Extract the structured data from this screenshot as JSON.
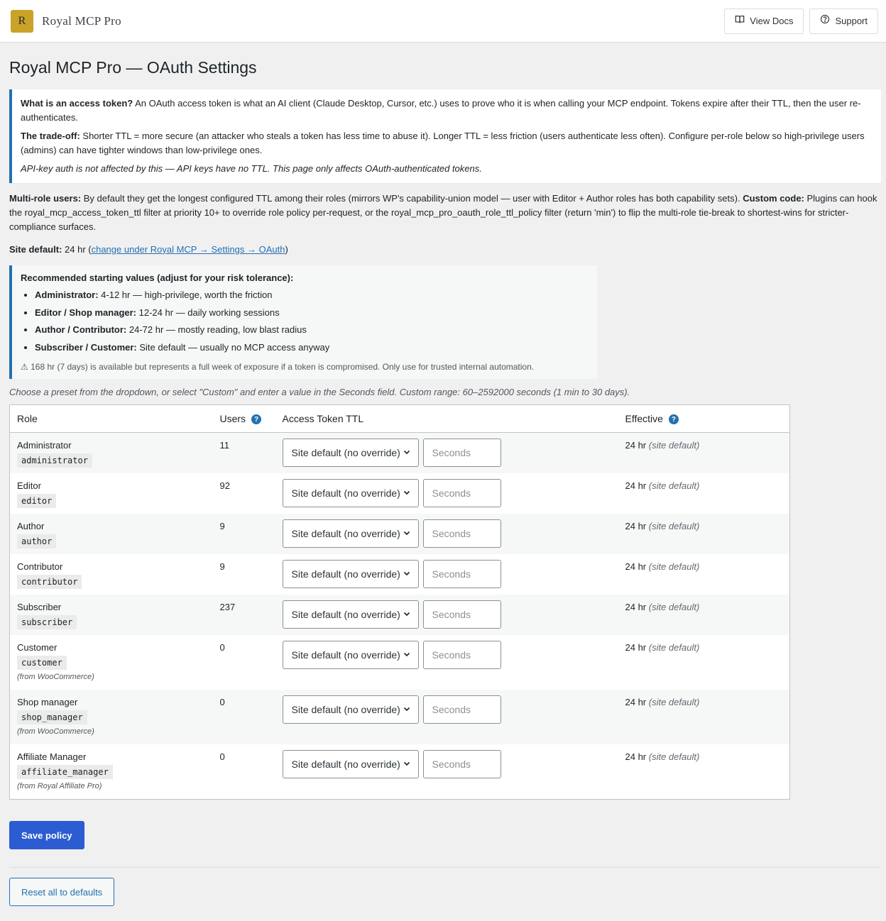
{
  "header": {
    "logo_letter": "R",
    "brand": "Royal MCP Pro",
    "view_docs": "View Docs",
    "support": "Support"
  },
  "page_title": "Royal MCP Pro — OAuth Settings",
  "notice": {
    "q_label": "What is an access token?",
    "q_text": " An OAuth access token is what an AI client (Claude Desktop, Cursor, etc.) uses to prove who it is when calling your MCP endpoint. Tokens expire after their TTL, then the user re-authenticates.",
    "trade_label": "The trade-off:",
    "trade_text": " Shorter TTL = more secure (an attacker who steals a token has less time to abuse it). Longer TTL = less friction (users authenticate less often). Configure per-role below so high-privilege users (admins) can have tighter windows than low-privilege ones.",
    "apikey_text": "API-key auth is not affected by this — API keys have no TTL. This page only affects OAuth-authenticated tokens."
  },
  "multirole": {
    "label": "Multi-role users:",
    "text": " By default they get the longest configured TTL among their roles (mirrors WP's capability-union model — user with Editor + Author roles has both capability sets). ",
    "custom_label": "Custom code:",
    "custom_text": " Plugins can hook the royal_mcp_access_token_ttl filter at priority 10+ to override role policy per-request, or the royal_mcp_pro_oauth_role_ttl_policy filter (return 'min') to flip the multi-role tie-break to shortest-wins for stricter-compliance surfaces."
  },
  "site_default": {
    "label": "Site default:",
    "value": " 24 hr (",
    "link": "change under Royal MCP → Settings → OAuth",
    "close": ")"
  },
  "recommended": {
    "title": "Recommended starting values (adjust for your risk tolerance):",
    "items": [
      {
        "role": "Administrator:",
        "text": " 4-12 hr — high-privilege, worth the friction"
      },
      {
        "role": "Editor / Shop manager:",
        "text": " 12-24 hr — daily working sessions"
      },
      {
        "role": "Author / Contributor:",
        "text": " 24-72 hr — mostly reading, low blast radius"
      },
      {
        "role": "Subscriber / Customer:",
        "text": " Site default — usually no MCP access anyway"
      }
    ],
    "warning": "⚠ 168 hr (7 days) is available but represents a full week of exposure if a token is compromised. Only use for trusted internal automation."
  },
  "hint": "Choose a preset from the dropdown, or select \"Custom\" and enter a value in the Seconds field. Custom range: 60–2592000 seconds (1 min to 30 days).",
  "table": {
    "headers": {
      "role": "Role",
      "users": "Users",
      "ttl": "Access Token TTL",
      "effective": "Effective"
    },
    "select_value": "Site default (no override)",
    "seconds_placeholder": "Seconds",
    "effective_value": "24 hr",
    "effective_note": "(site default)",
    "rows": [
      {
        "name": "Administrator",
        "slug": "administrator",
        "users": "11",
        "from": ""
      },
      {
        "name": "Editor",
        "slug": "editor",
        "users": "92",
        "from": ""
      },
      {
        "name": "Author",
        "slug": "author",
        "users": "9",
        "from": ""
      },
      {
        "name": "Contributor",
        "slug": "contributor",
        "users": "9",
        "from": ""
      },
      {
        "name": "Subscriber",
        "slug": "subscriber",
        "users": "237",
        "from": ""
      },
      {
        "name": "Customer",
        "slug": "customer",
        "users": "0",
        "from": "(from WooCommerce)"
      },
      {
        "name": "Shop manager",
        "slug": "shop_manager",
        "users": "0",
        "from": "(from WooCommerce)"
      },
      {
        "name": "Affiliate Manager",
        "slug": "affiliate_manager",
        "users": "0",
        "from": "(from Royal Affiliate Pro)"
      }
    ]
  },
  "buttons": {
    "save": "Save policy",
    "reset": "Reset all to defaults"
  }
}
